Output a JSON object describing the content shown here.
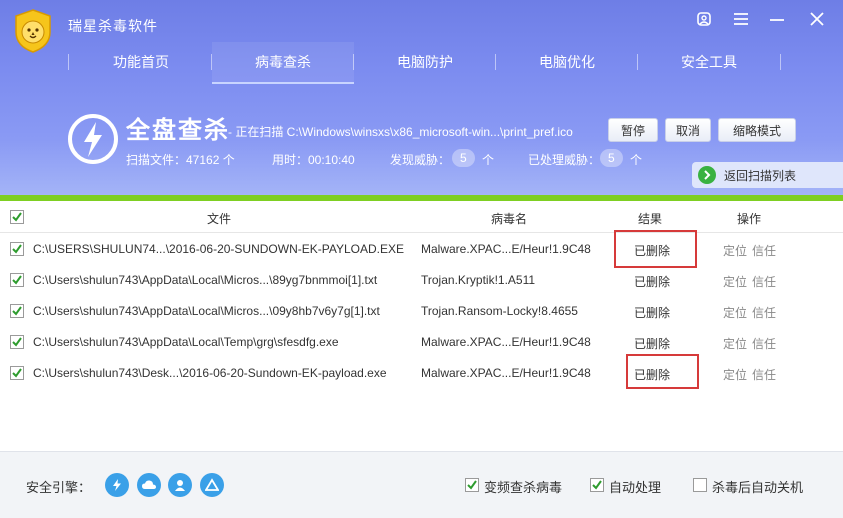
{
  "app": {
    "title": "瑞星杀毒软件"
  },
  "nav": [
    {
      "label": "功能首页"
    },
    {
      "label": "病毒查杀",
      "active": true
    },
    {
      "label": "电脑防护"
    },
    {
      "label": "电脑优化"
    },
    {
      "label": "安全工具"
    }
  ],
  "scan": {
    "title": "全盘查杀",
    "status_path": "- 正在扫描 C:\\Windows\\winsxs\\x86_microsoft-win...\\print_pref.ico",
    "pause_label": "暂停",
    "cancel_label": "取消",
    "mini_label": "缩略模式",
    "files_label": "扫描文件：47162 个",
    "time_label": "用时：00:10:40",
    "threats_label": "发现威胁：",
    "threats_count": "5",
    "threats_unit": "个",
    "handled_label": "已处理威胁：",
    "handled_count": "5",
    "handled_unit": "个",
    "return_label": "返回扫描列表",
    "progress_percent": 100
  },
  "table": {
    "headers": {
      "file": "文件",
      "virus": "病毒名",
      "result": "结果",
      "action": "操作"
    },
    "rows": [
      {
        "file": "C:\\USERS\\SHULUN74...\\2016-06-20-SUNDOWN-EK-PAYLOAD.EXE",
        "virus": "Malware.XPAC...E/Heur!1.9C48",
        "result": "已删除",
        "locate": "定位",
        "trust": "信任"
      },
      {
        "file": "C:\\Users\\shulun743\\AppData\\Local\\Micros...\\89yg7bnmmoi[1].txt",
        "virus": "Trojan.Kryptik!1.A511",
        "result": "已删除",
        "locate": "定位",
        "trust": "信任"
      },
      {
        "file": "C:\\Users\\shulun743\\AppData\\Local\\Micros...\\09y8hb7v6y7g[1].txt",
        "virus": "Trojan.Ransom-Locky!8.4655",
        "result": "已删除",
        "locate": "定位",
        "trust": "信任"
      },
      {
        "file": "C:\\Users\\shulun743\\AppData\\Local\\Temp\\grg\\sfesdfg.exe",
        "virus": "Malware.XPAC...E/Heur!1.9C48",
        "result": "已删除",
        "locate": "定位",
        "trust": "信任"
      },
      {
        "file": "C:\\Users\\shulun743\\Desk...\\2016-06-20-Sundown-EK-payload.exe",
        "virus": "Malware.XPAC...E/Heur!1.9C48",
        "result": "已删除",
        "locate": "定位",
        "trust": "信任"
      }
    ]
  },
  "footer": {
    "engine_label": "安全引擎：",
    "engines": [
      "lightning-icon",
      "cloud-icon",
      "user-icon",
      "triangle-icon"
    ],
    "options": [
      {
        "label": "变频查杀病毒",
        "checked": true
      },
      {
        "label": "自动处理",
        "checked": true
      },
      {
        "label": "杀毒后自动关机",
        "checked": false
      }
    ]
  },
  "colors": {
    "header": "#7c8cf0",
    "progress": "#7ecf22",
    "highlight": "#d63a3a",
    "accent_green": "#3ab241",
    "engine_blue": "#3aa0e8"
  }
}
